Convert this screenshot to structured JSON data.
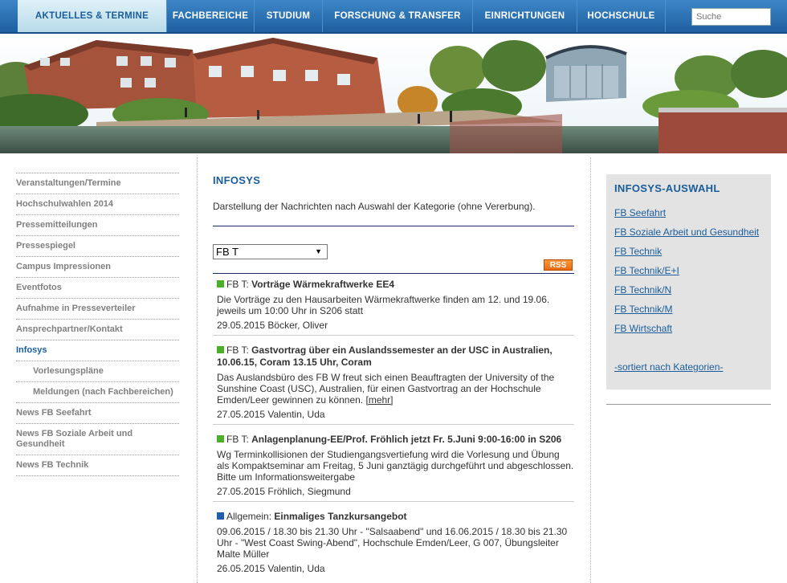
{
  "nav": {
    "items": [
      {
        "label": "AKTUELLES & TERMINE"
      },
      {
        "label": "FACHBEREICHE"
      },
      {
        "label": "STUDIUM"
      },
      {
        "label": "FORSCHUNG & TRANSFER"
      },
      {
        "label": "EINRICHTUNGEN"
      },
      {
        "label": "HOCHSCHULE"
      }
    ],
    "search_placeholder": "Suche"
  },
  "sidebar": {
    "items": [
      {
        "label": "Veranstaltungen/Termine"
      },
      {
        "label": "Hochschulwahlen 2014"
      },
      {
        "label": "Pressemitteilungen"
      },
      {
        "label": "Pressespiegel"
      },
      {
        "label": "Campus Impressionen"
      },
      {
        "label": "Eventfotos"
      },
      {
        "label": "Aufnahme in Presseverteiler"
      },
      {
        "label": "Ansprechpartner/Kontakt"
      },
      {
        "label": "Infosys"
      },
      {
        "label": "Vorlesungspläne"
      },
      {
        "label": "Meldungen (nach Fachbereichen)"
      },
      {
        "label": "News FB Seefahrt"
      },
      {
        "label": "News FB Soziale Arbeit und Gesundheit"
      },
      {
        "label": "News FB Technik"
      }
    ]
  },
  "main": {
    "title": "INFOSYS",
    "intro": "Darstellung der Nachrichten nach Auswahl der Kategorie (ohne Vererbung).",
    "select_value": "FB T",
    "rss_label": "RSS",
    "news": [
      {
        "category": "FB T:",
        "title": "Vorträge Wärmekraftwerke EE4",
        "body": "Die Vorträge zu den Hausarbeiten Wärmekraftwerke finden am 12. und 19.06. jeweils um 10:00 Uhr in S206 statt",
        "more": "",
        "meta": "29.05.2015 Böcker, Oliver"
      },
      {
        "category": "FB T:",
        "title": "Gastvortrag über ein Auslandssemester an der USC in Australien, 10.06.15, Coram 13.15 Uhr, Coram",
        "body": "Das Auslandsbüro des FB W freut sich einen Beauftragten der University of the Sunshine Coast (USC), Australien, für einen Gastvortrag an der Hochschule Emden/Leer gewinnen zu können.",
        "more": "[mehr]",
        "meta": "27.05.2015 Valentin, Uda"
      },
      {
        "category": "FB T:",
        "title": "Anlagenplanung-EE/Prof. Fröhlich jetzt Fr. 5.Juni 9:00-16:00 in S206",
        "body": "Wg Terminkollisionen der Studiengangsvertiefung wird die Vorlesung und Übung als Kompaktseminar am Freitag, 5 Juni ganztägig durchgeführt und abgeschlossen. Bitte um Informationsweitergabe",
        "more": "",
        "meta": "27.05.2015 Fröhlich, Siegmund"
      },
      {
        "category": "Allgemein:",
        "title": "Einmaliges Tanzkursangebot",
        "body": "09.06.2015 / 18.30 bis 21.30 Uhr - \"Salsaabend\" und 16.06.2015 / 18.30 bis 21.30 Uhr - \"West Coast Swing-Abend\", Hochschule Emden/Leer, G 007, Übungsleiter Malte Müller",
        "more": "",
        "meta": "26.05.2015 Valentin, Uda"
      }
    ]
  },
  "right": {
    "title": "INFOSYS-AUSWAHL",
    "links": [
      {
        "label": "FB Seefahrt"
      },
      {
        "label": "FB Soziale Arbeit und Gesundheit"
      },
      {
        "label": "FB Technik"
      },
      {
        "label": "FB Technik/E+I"
      },
      {
        "label": "FB Technik/N"
      },
      {
        "label": "FB Technik/M"
      },
      {
        "label": "FB Wirtschaft"
      }
    ],
    "sorted_label": "-sortiert nach Kategorien-"
  },
  "colors": {
    "nav_blue": "#1d5f9f",
    "accent": "#1a5d9a",
    "marker_fbt": "#4caf2a",
    "marker_allgemein": "#1f5fae",
    "rss": "#e86a10"
  }
}
